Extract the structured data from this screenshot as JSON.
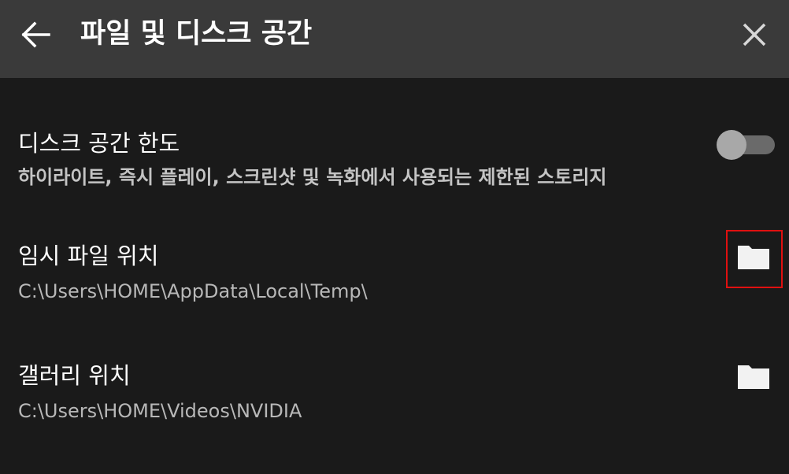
{
  "header": {
    "title": "파일 및 디스크 공간",
    "back_icon": "arrow-left-icon",
    "close_icon": "close-icon"
  },
  "disk_limit": {
    "title": "디스크 공간 한도",
    "description": "하이라이트, 즉시 플레이, 스크린샷 및 녹화에서 사용되는 제한된 스토리지",
    "enabled": false
  },
  "temp_location": {
    "title": "임시 파일 위치",
    "path": "C:\\Users\\HOME\\AppData\\Local\\Temp\\",
    "icon": "folder-icon"
  },
  "gallery_location": {
    "title": "갤러리 위치",
    "path": "C:\\Users\\HOME\\Videos\\NVIDIA",
    "icon": "folder-icon"
  },
  "colors": {
    "background": "#1a1a1a",
    "header_background": "#3a3a3a",
    "highlight_border": "#e01010"
  }
}
